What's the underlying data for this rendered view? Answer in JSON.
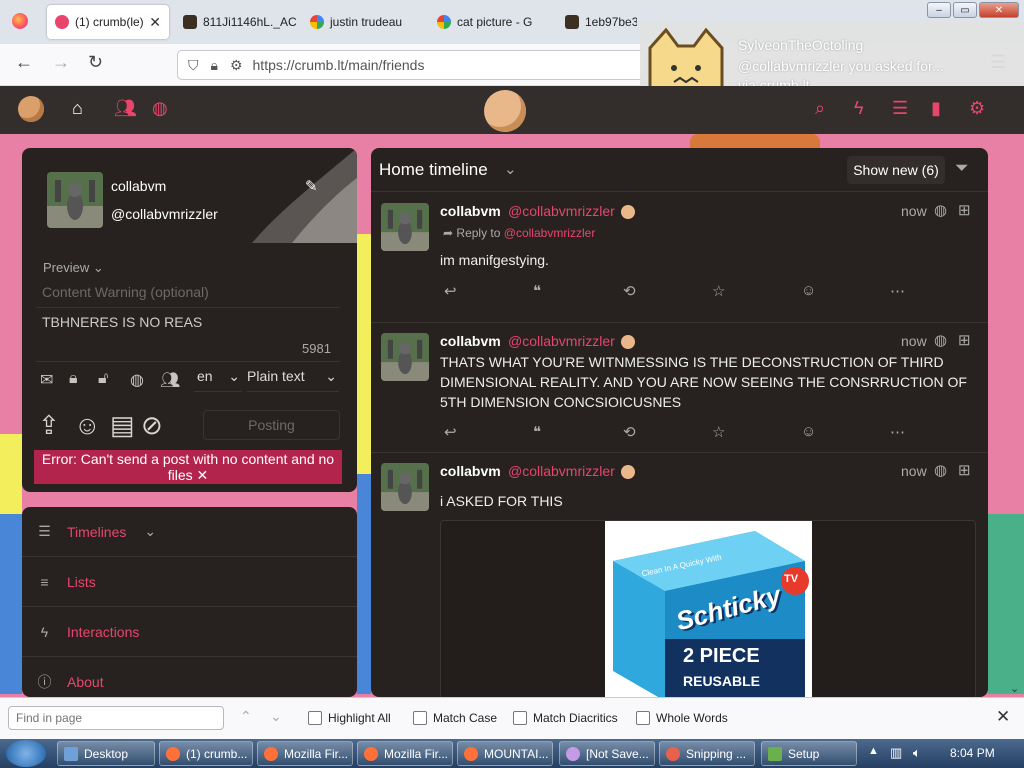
{
  "browser": {
    "tabs": [
      {
        "label": "(1) crumb(le)"
      },
      {
        "label": "811Ji1146hL._AC"
      },
      {
        "label": "justin trudeau"
      },
      {
        "label": "cat picture - G"
      },
      {
        "label": "1eb97be3"
      }
    ],
    "url": "https://crumb.lt/main/friends"
  },
  "notification": {
    "title": "SylveonTheOctoling",
    "body": "@collabvmrizzler you asked for...",
    "source": "via crumb.lt"
  },
  "compose": {
    "display_name": "collabvm",
    "handle": "@collabvmrizzler",
    "preview_label": "Preview",
    "cw_placeholder": "Content Warning (optional)",
    "text": "TBHNERES IS NO REAS",
    "char_count": "5981",
    "language": "en",
    "format": "Plain text",
    "post_button": "Posting",
    "error": "Error: Can't send a post with no content and no files"
  },
  "nav": {
    "items": [
      {
        "label": "Timelines",
        "icon": "menu-icon"
      },
      {
        "label": "Lists",
        "icon": "list-icon"
      },
      {
        "label": "Interactions",
        "icon": "bolt-icon"
      },
      {
        "label": "About",
        "icon": "info-icon"
      }
    ]
  },
  "timeline": {
    "title": "Home timeline",
    "show_new": "Show new (6)",
    "posts": [
      {
        "name": "collabvm",
        "handle": "@collabvmrizzler",
        "time": "now",
        "reply_prefix": "Reply to",
        "reply_handle": "@collabvmrizzler",
        "text": "im manifgestying."
      },
      {
        "name": "collabvm",
        "handle": "@collabvmrizzler",
        "time": "now",
        "text": "THATS WHAT YOU'RE WITNMESSING IS THE DECONSTRUCTION OF THIRD DIMENSIONAL REALITY. AND YOU ARE NOW SEEING THE CONSRRUCTION OF 5TH DIMENSION CONCSIOICUSNES"
      },
      {
        "name": "collabvm",
        "handle": "@collabvmrizzler",
        "time": "now",
        "text": "i ASKED FOR THIS",
        "image": {
          "top_text": "Clean In A Quicky With",
          "brand": "Schticky",
          "piece": "2 PIECE",
          "reusable": "REUSABLE",
          "badge": "TV"
        }
      }
    ]
  },
  "findbar": {
    "placeholder": "Find in page",
    "options": [
      "Highlight All",
      "Match Case",
      "Match Diacritics",
      "Whole Words"
    ]
  },
  "taskbar": {
    "items": [
      {
        "label": "Desktop"
      },
      {
        "label": "(1) crumb..."
      },
      {
        "label": "Mozilla Fir..."
      },
      {
        "label": "Mozilla Fir..."
      },
      {
        "label": "MOUNTAI..."
      },
      {
        "label": "[Not Save..."
      },
      {
        "label": "Snipping ..."
      },
      {
        "label": "Setup"
      }
    ],
    "clock": "8:04 PM"
  },
  "colors": {
    "accent": "#e8456d",
    "panel": "#272220",
    "header": "#332d2b",
    "error_bg": "#b3244c"
  }
}
